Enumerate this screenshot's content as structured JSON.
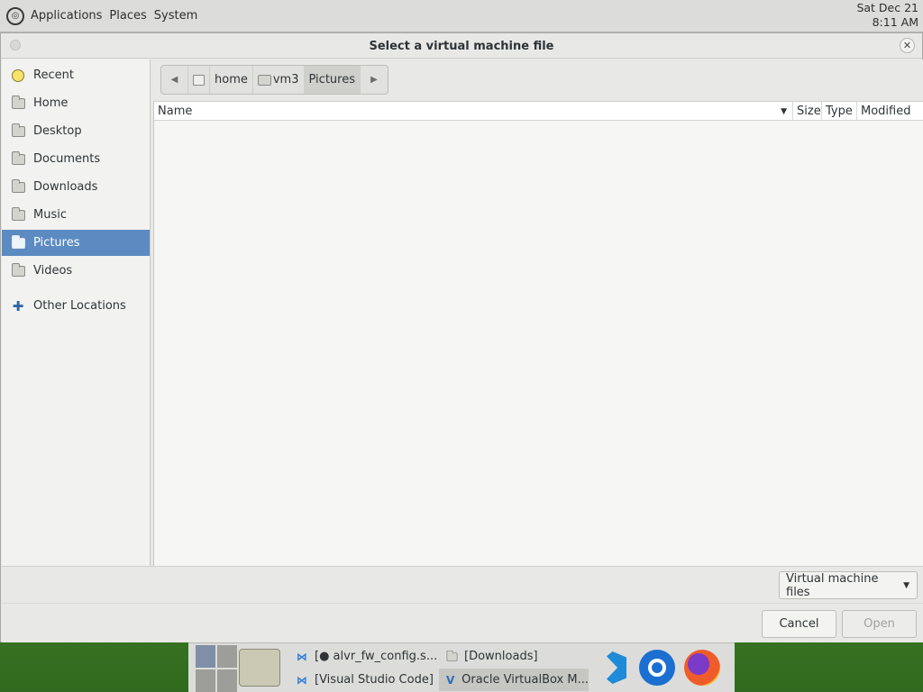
{
  "top_panel": {
    "menus": [
      "Applications",
      "Places",
      "System"
    ],
    "clock_date": "Sat Dec 21",
    "clock_time": "8:11 AM"
  },
  "dialog": {
    "title": "Select a virtual machine file",
    "close_icon": "close-icon"
  },
  "sidebar": {
    "items": [
      {
        "label": "Recent",
        "icon": "recent-icon"
      },
      {
        "label": "Home",
        "icon": "home-folder-icon"
      },
      {
        "label": "Desktop",
        "icon": "folder-icon"
      },
      {
        "label": "Documents",
        "icon": "folder-icon"
      },
      {
        "label": "Downloads",
        "icon": "folder-icon"
      },
      {
        "label": "Music",
        "icon": "folder-icon"
      },
      {
        "label": "Pictures",
        "icon": "folder-icon",
        "selected": true
      },
      {
        "label": "Videos",
        "icon": "folder-icon"
      },
      {
        "label": "Other Locations",
        "icon": "plus-icon"
      }
    ],
    "selected_color": "#5b8bc1"
  },
  "pathbar": {
    "segments": [
      "home",
      "vm3",
      "Pictures"
    ]
  },
  "file_list": {
    "columns": [
      "Name",
      "Size",
      "Type",
      "Modified"
    ]
  },
  "filter": {
    "selected": "Virtual machine files"
  },
  "actions": {
    "cancel": "Cancel",
    "open": "Open"
  },
  "taskbar": {
    "tasks": [
      {
        "label": "[● alvr_fw_config.s...",
        "icon": "vscode-icon"
      },
      {
        "label": "[Downloads]",
        "icon": "folder-icon"
      },
      {
        "label": "[Visual Studio Code]",
        "icon": "vscode-icon"
      },
      {
        "label": "Oracle VirtualBox M...",
        "icon": "virtualbox-icon",
        "active": true
      }
    ],
    "pinned": [
      "vscode-icon",
      "chrome-icon",
      "firefox-icon"
    ]
  }
}
